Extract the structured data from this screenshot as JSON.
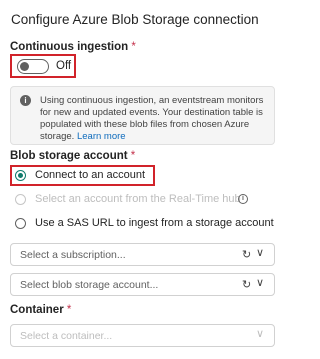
{
  "title": "Configure Azure Blob Storage connection",
  "continuous_ingestion": {
    "label": "Continuous ingestion",
    "required_marker": "*",
    "toggle_state": "Off"
  },
  "info": {
    "icon": "info-icon",
    "text": "Using continuous ingestion, an eventstream monitors for new and updated events. Your destination table is populated with these blob files from chosen Azure storage.",
    "link": "Learn more"
  },
  "blob_account": {
    "label": "Blob storage account",
    "required_marker": "*",
    "options": [
      {
        "label": "Connect to an account",
        "checked": true,
        "disabled": false
      },
      {
        "label": "Select an account from the Real-Time hub",
        "checked": false,
        "disabled": true
      },
      {
        "label": "Use a SAS URL to ingest from a storage account",
        "checked": false,
        "disabled": false
      }
    ]
  },
  "dropdowns": {
    "subscription_placeholder": "Select a subscription...",
    "account_placeholder": "Select blob storage account..."
  },
  "container": {
    "label": "Container",
    "required_marker": "*",
    "placeholder": "Select a container..."
  },
  "colors": {
    "accent": "#0f7b6c",
    "highlight": "#d1232a",
    "link": "#0f6cbd"
  }
}
